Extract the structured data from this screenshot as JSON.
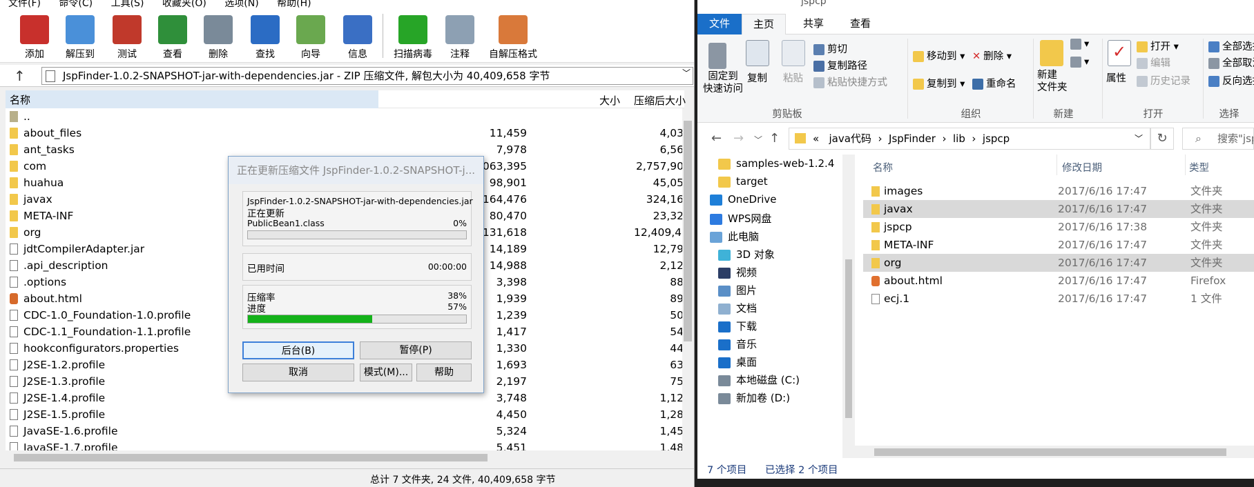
{
  "winrar": {
    "menu": [
      "文件(F)",
      "命令(C)",
      "工具(S)",
      "收藏夹(O)",
      "选项(N)",
      "帮助(H)"
    ],
    "toolbar": [
      {
        "label": "添加",
        "icon": "add-archive-icon",
        "color": "#c8302c"
      },
      {
        "label": "解压到",
        "icon": "extract-folder-icon",
        "color": "#4a90d9"
      },
      {
        "label": "测试",
        "icon": "test-checklist-icon",
        "color": "#c0392b"
      },
      {
        "label": "查看",
        "icon": "view-book-icon",
        "color": "#2f8f3a"
      },
      {
        "label": "删除",
        "icon": "delete-trash-icon",
        "color": "#7a8a99"
      },
      {
        "label": "查找",
        "icon": "find-magnifier-icon",
        "color": "#2b6cc4"
      },
      {
        "label": "向导",
        "icon": "wizard-wand-icon",
        "color": "#6aa84f"
      },
      {
        "label": "信息",
        "icon": "info-icon",
        "color": "#3a6fc4"
      },
      {
        "label": "扫描病毒",
        "icon": "virus-scan-icon",
        "color": "#27a527"
      },
      {
        "label": "注释",
        "icon": "comment-icon",
        "color": "#8da0b3"
      },
      {
        "label": "自解压格式",
        "icon": "sfx-box-icon",
        "color": "#d9793a"
      }
    ],
    "address": "JspFinder-1.0.2-SNAPSHOT-jar-with-dependencies.jar - ZIP 压缩文件, 解包大小为 40,409,658 字节",
    "columns": {
      "name": "名称",
      "size": "大小",
      "packed": "压缩后大小"
    },
    "files": [
      {
        "name": "..",
        "type": "up",
        "size": "",
        "packed": ""
      },
      {
        "name": "about_files",
        "type": "folder",
        "size": "11,459",
        "packed": "4,03"
      },
      {
        "name": "ant_tasks",
        "type": "folder",
        "size": "7,978",
        "packed": "6,56"
      },
      {
        "name": "com",
        "type": "folder",
        "size": "7,063,395",
        "packed": "2,757,90"
      },
      {
        "name": "huahua",
        "type": "folder",
        "size": "98,901",
        "packed": "45,05"
      },
      {
        "name": "javax",
        "type": "folder",
        "size": "1,164,476",
        "packed": "324,16"
      },
      {
        "name": "META-INF",
        "type": "folder",
        "size": "80,470",
        "packed": "23,32"
      },
      {
        "name": "org",
        "type": "folder",
        "size": "29,131,618",
        "packed": "12,409,49"
      },
      {
        "name": "jdtCompilerAdapter.jar",
        "type": "file",
        "size": "14,189",
        "packed": "12,79"
      },
      {
        "name": ".api_description",
        "type": "file",
        "size": "14,988",
        "packed": "2,12"
      },
      {
        "name": ".options",
        "type": "file",
        "size": "3,398",
        "packed": "88"
      },
      {
        "name": "about.html",
        "type": "html",
        "size": "1,939",
        "packed": "89"
      },
      {
        "name": "CDC-1.0_Foundation-1.0.profile",
        "type": "file",
        "size": "1,239",
        "packed": "50"
      },
      {
        "name": "CDC-1.1_Foundation-1.1.profile",
        "type": "file",
        "size": "1,417",
        "packed": "54"
      },
      {
        "name": "hookconfigurators.properties",
        "type": "file",
        "size": "1,330",
        "packed": "44"
      },
      {
        "name": "J2SE-1.2.profile",
        "type": "file",
        "size": "1,693",
        "packed": "63"
      },
      {
        "name": "J2SE-1.3.profile",
        "type": "file",
        "size": "2,197",
        "packed": "75"
      },
      {
        "name": "J2SE-1.4.profile",
        "type": "file",
        "size": "3,748",
        "packed": "1,12"
      },
      {
        "name": "J2SE-1.5.profile",
        "type": "file",
        "size": "4,450",
        "packed": "1,28"
      },
      {
        "name": "JavaSE-1.6.profile",
        "type": "file",
        "size": "5,324",
        "packed": "1,45"
      },
      {
        "name": "JavaSE-1.7.profile",
        "type": "file",
        "size": "5,451",
        "packed": "1,48"
      }
    ],
    "status": "总计 7 文件夹, 24 文件, 40,409,658 字节"
  },
  "dialog": {
    "title": "正在更新压缩文件 JspFinder-1.0.2-SNAPSHOT-j...",
    "archive": "JspFinder-1.0.2-SNAPSHOT-jar-with-dependencies.jar",
    "action": "正在更新",
    "current_file": "PublicBean1.class",
    "file_percent": "0%",
    "file_progress": 0,
    "elapsed_label": "已用时间",
    "elapsed": "00:00:00",
    "ratio_label": "压缩率",
    "ratio": "38%",
    "progress_label": "进度",
    "progress": "57%",
    "progress_value": 0.57,
    "buttons": {
      "background": "后台(B)",
      "pause": "暂停(P)",
      "cancel": "取消",
      "mode": "模式(M)...",
      "help": "帮助"
    }
  },
  "explorer": {
    "window_title": "jspcp",
    "tabs": {
      "file": "文件",
      "home": "主页",
      "share": "共享",
      "view": "查看"
    },
    "ribbon": {
      "pin": "固定到\n快速访问",
      "copy": "复制",
      "paste": "粘贴",
      "cut": "剪切",
      "copy_path": "复制路径",
      "paste_shortcut": "粘贴快捷方式",
      "group_clipboard": "剪贴板",
      "move_to": "移动到",
      "copy_to": "复制到",
      "delete": "删除",
      "rename": "重命名",
      "group_organize": "组织",
      "new_folder": "新建\n文件夹",
      "group_new": "新建",
      "properties": "属性",
      "open": "打开",
      "edit": "编辑",
      "history": "历史记录",
      "group_open": "打开",
      "select_all": "全部选择",
      "select_none": "全部取消",
      "invert": "反向选择",
      "group_select": "选择"
    },
    "breadcrumb": [
      "«",
      "java代码",
      "JspFinder",
      "lib",
      "jspcp"
    ],
    "search_placeholder": "搜索\"jspcp\"",
    "nav": [
      {
        "label": "samples-web-1.2.4",
        "icon": "folder-icon",
        "color": "#f2c84b",
        "indent": 1
      },
      {
        "label": "target",
        "icon": "folder-icon",
        "color": "#f2c84b",
        "indent": 1
      },
      {
        "label": "OneDrive",
        "icon": "onedrive-icon",
        "color": "#1e7fd8",
        "indent": 0
      },
      {
        "label": "WPS网盘",
        "icon": "wps-cloud-icon",
        "color": "#2d7be0",
        "indent": 0
      },
      {
        "label": "此电脑",
        "icon": "this-pc-icon",
        "color": "#6aa3d8",
        "indent": 0
      },
      {
        "label": "3D 对象",
        "icon": "3d-objects-icon",
        "color": "#3fb2d8",
        "indent": 1
      },
      {
        "label": "视频",
        "icon": "video-icon",
        "color": "#2c3e66",
        "indent": 1
      },
      {
        "label": "图片",
        "icon": "pictures-icon",
        "color": "#5a8fc7",
        "indent": 1
      },
      {
        "label": "文档",
        "icon": "documents-icon",
        "color": "#8fb0d0",
        "indent": 1
      },
      {
        "label": "下载",
        "icon": "download-icon",
        "color": "#1a6fc9",
        "indent": 1
      },
      {
        "label": "音乐",
        "icon": "music-icon",
        "color": "#1a6fc9",
        "indent": 1
      },
      {
        "label": "桌面",
        "icon": "desktop-icon",
        "color": "#1a6fc9",
        "indent": 1
      },
      {
        "label": "本地磁盘 (C:)",
        "icon": "drive-c-icon",
        "color": "#7a8a99",
        "indent": 1
      },
      {
        "label": "新加卷 (D:)",
        "icon": "drive-d-icon",
        "color": "#7a8a99",
        "indent": 1
      }
    ],
    "columns": {
      "name": "名称",
      "date": "修改日期",
      "type": "类型"
    },
    "files": [
      {
        "name": "images",
        "kind": "folder",
        "date": "2017/6/16 17:47",
        "type": "文件夹",
        "selected": false
      },
      {
        "name": "javax",
        "kind": "folder",
        "date": "2017/6/16 17:47",
        "type": "文件夹",
        "selected": true
      },
      {
        "name": "jspcp",
        "kind": "folder",
        "date": "2017/6/16 17:38",
        "type": "文件夹",
        "selected": false
      },
      {
        "name": "META-INF",
        "kind": "folder",
        "date": "2017/6/16 17:47",
        "type": "文件夹",
        "selected": false
      },
      {
        "name": "org",
        "kind": "folder",
        "date": "2017/6/16 17:47",
        "type": "文件夹",
        "selected": true
      },
      {
        "name": "about.html",
        "kind": "html",
        "date": "2017/6/16 17:47",
        "type": "Firefox",
        "selected": false
      },
      {
        "name": "ecj.1",
        "kind": "file",
        "date": "2017/6/16 17:47",
        "type": "1 文件",
        "selected": false
      }
    ],
    "status_count": "7 个项目",
    "status_selected": "已选择 2 个项目"
  }
}
